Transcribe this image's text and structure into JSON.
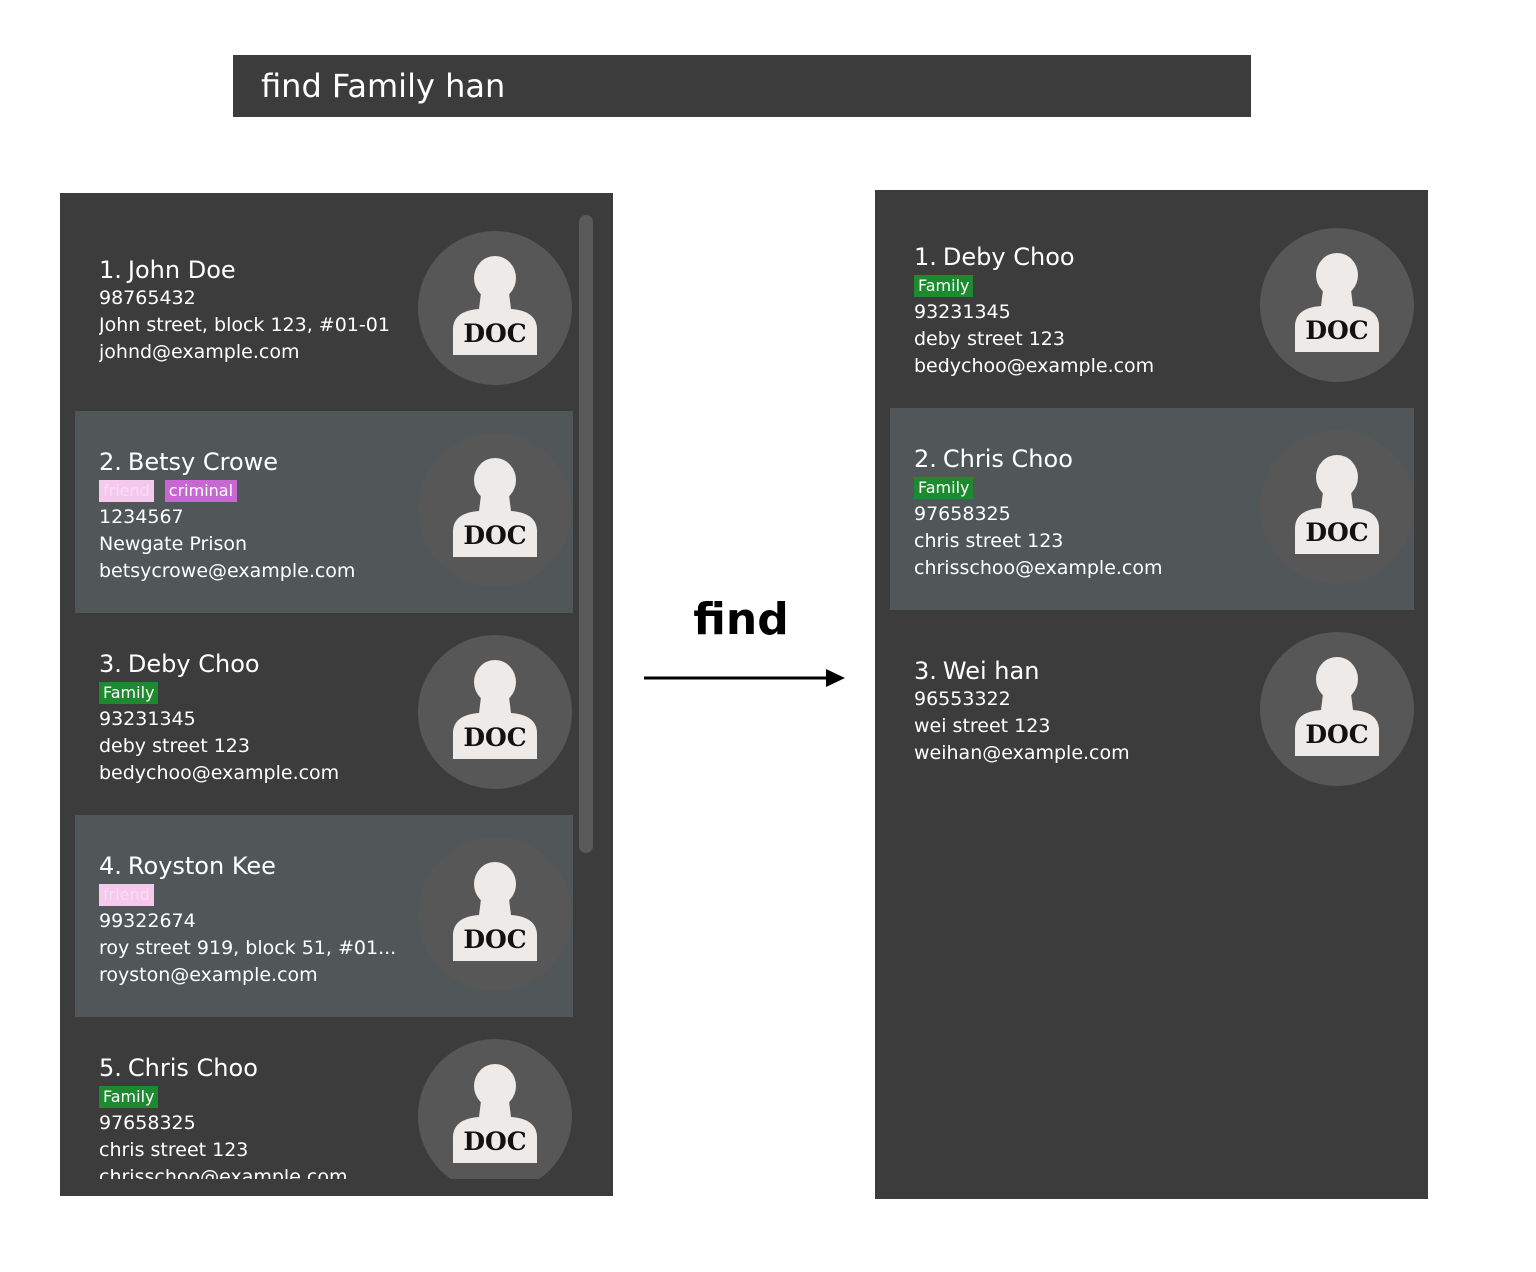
{
  "command": {
    "text": "find Family han"
  },
  "arrow": {
    "label": "find"
  },
  "avatar": {
    "icon": "person-doc-icon",
    "text": "DOC"
  },
  "tag_colors": {
    "Family": "#1d8a2f",
    "friend": "#f4c9ec",
    "criminal": "#c767d1"
  },
  "before": {
    "persons": [
      {
        "index": "1.",
        "name": "John Doe",
        "tags": [],
        "phone": "98765432",
        "address": "John street, block 123, #01-01",
        "email": "johnd@example.com"
      },
      {
        "index": "2.",
        "name": "Betsy Crowe",
        "tags": [
          "friend",
          "criminal"
        ],
        "phone": "1234567",
        "address": "Newgate Prison",
        "email": "betsycrowe@example.com"
      },
      {
        "index": "3.",
        "name": "Deby Choo",
        "tags": [
          "Family"
        ],
        "phone": "93231345",
        "address": "deby street 123",
        "email": "bedychoo@example.com"
      },
      {
        "index": "4.",
        "name": "Royston Kee",
        "tags": [
          "friend"
        ],
        "phone": "99322674",
        "address": "roy street 919, block 51, #01...",
        "email": "royston@example.com"
      },
      {
        "index": "5.",
        "name": "Chris Choo",
        "tags": [
          "Family"
        ],
        "phone": "97658325",
        "address": "chris street 123",
        "email": "chrisschoo@example.com"
      }
    ]
  },
  "after": {
    "persons": [
      {
        "index": "1.",
        "name": "Deby Choo",
        "tags": [
          "Family"
        ],
        "phone": "93231345",
        "address": "deby street 123",
        "email": "bedychoo@example.com"
      },
      {
        "index": "2.",
        "name": "Chris Choo",
        "tags": [
          "Family"
        ],
        "phone": "97658325",
        "address": "chris street 123",
        "email": "chrisschoo@example.com"
      },
      {
        "index": "3.",
        "name": "Wei han",
        "tags": [],
        "phone": "96553322",
        "address": "wei street 123",
        "email": "weihan@example.com"
      }
    ]
  }
}
